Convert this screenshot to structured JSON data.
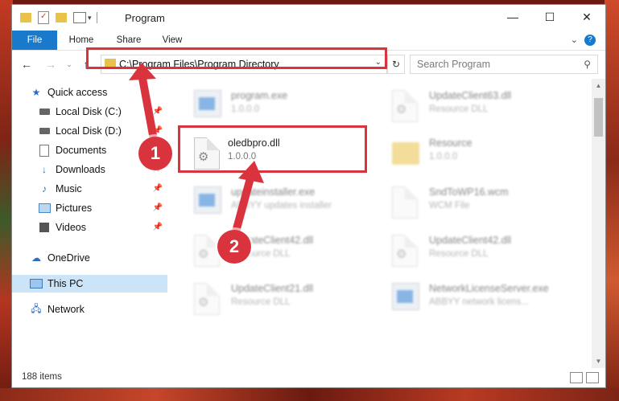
{
  "window": {
    "title": "Program",
    "minimize_glyph": "—",
    "maximize_glyph": "☐",
    "close_glyph": "✕"
  },
  "ribbon": {
    "tabs": [
      "File",
      "Home",
      "Share",
      "View"
    ],
    "help_glyph": "?"
  },
  "address": {
    "path": "C:\\Program Files\\Program Directory"
  },
  "search": {
    "placeholder": "Search Program"
  },
  "sidebar": {
    "items": [
      {
        "label": "Quick access",
        "icon": "star-icon"
      },
      {
        "label": "Local Disk (C:)",
        "icon": "drive-icon"
      },
      {
        "label": "Local Disk (D:)",
        "icon": "drive-icon"
      },
      {
        "label": "Documents",
        "icon": "documents-icon"
      },
      {
        "label": "Downloads",
        "icon": "downloads-icon"
      },
      {
        "label": "Music",
        "icon": "music-icon"
      },
      {
        "label": "Pictures",
        "icon": "pictures-icon"
      },
      {
        "label": "Videos",
        "icon": "videos-icon"
      },
      {
        "label": "OneDrive",
        "icon": "cloud-icon"
      },
      {
        "label": "This PC",
        "icon": "computer-icon"
      },
      {
        "label": "Network",
        "icon": "network-icon"
      }
    ]
  },
  "files": [
    {
      "name": "program.exe",
      "sub": "1.0.0.0"
    },
    {
      "name": "UpdateClient63.dll",
      "sub": "Resource DLL"
    },
    {
      "name": "oledbpro.dll",
      "sub": "1.0.0.0"
    },
    {
      "name": "Resource",
      "sub": "1.0.0.0"
    },
    {
      "name": "updateinstaller.exe",
      "sub": "ABBYY updates installer"
    },
    {
      "name": "SndToWP16.wcm",
      "sub": "WCM File"
    },
    {
      "name": "UpdateClient42.dll",
      "sub": "Resource DLL"
    },
    {
      "name": "UpdateClient42.dll",
      "sub": "Resource DLL"
    },
    {
      "name": "UpdateClient21.dll",
      "sub": "Resource DLL"
    },
    {
      "name": "NetworkLicenseServer.exe",
      "sub": "ABBYY network licens..."
    }
  ],
  "status": {
    "item_count": "188 items"
  },
  "annotations": {
    "step1": "1",
    "step2": "2",
    "color": "#d9343e"
  }
}
